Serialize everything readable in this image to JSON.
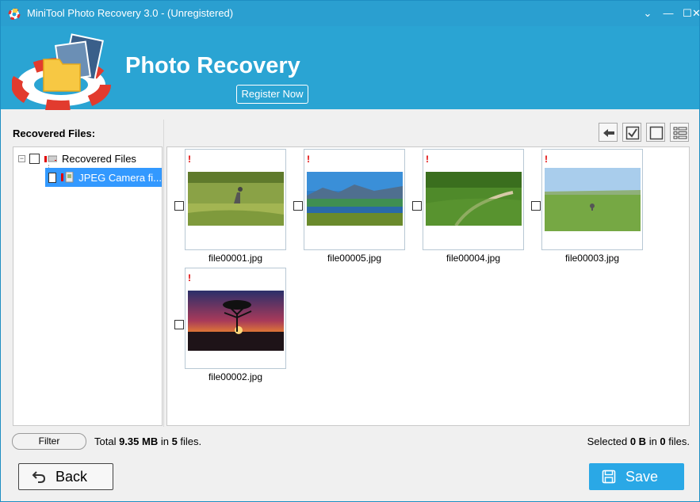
{
  "window": {
    "title": "MiniTool Photo Recovery 3.0 - (Unregistered)",
    "controls": {
      "menu": "⌄",
      "minimize": "—",
      "maximize": "☐",
      "close": "✕"
    }
  },
  "header": {
    "product_title": "Photo Recovery",
    "register_label": "Register Now"
  },
  "sidebar": {
    "label": "Recovered Files:",
    "tree": {
      "root": {
        "label": "Recovered Files",
        "expander": "−"
      },
      "child": {
        "label": "JPEG Camera fi..."
      }
    }
  },
  "toolbar": {
    "icons": [
      "back-arrow-icon",
      "check-all-icon",
      "uncheck-all-icon",
      "list-view-icon"
    ]
  },
  "files": [
    {
      "name": "file00001.jpg",
      "warn": "!"
    },
    {
      "name": "file00005.jpg",
      "warn": "!"
    },
    {
      "name": "file00004.jpg",
      "warn": "!"
    },
    {
      "name": "file00003.jpg",
      "warn": "!"
    },
    {
      "name": "file00002.jpg",
      "warn": "!"
    }
  ],
  "status": {
    "filter_label": "Filter",
    "total_prefix": "Total ",
    "total_size": "9.35 MB",
    "total_mid": " in ",
    "total_count": "5",
    "total_suffix": " files.",
    "selected_prefix": "Selected ",
    "selected_size": "0 B",
    "selected_mid": " in ",
    "selected_count": "0",
    "selected_suffix": " files."
  },
  "footer": {
    "back_label": "Back",
    "save_label": "Save"
  },
  "colors": {
    "titlebar": "#2a9fd0",
    "banner": "#2aa4d3",
    "selection": "#3399ff",
    "save_button": "#2aa8e6",
    "warning": "#e00000"
  }
}
